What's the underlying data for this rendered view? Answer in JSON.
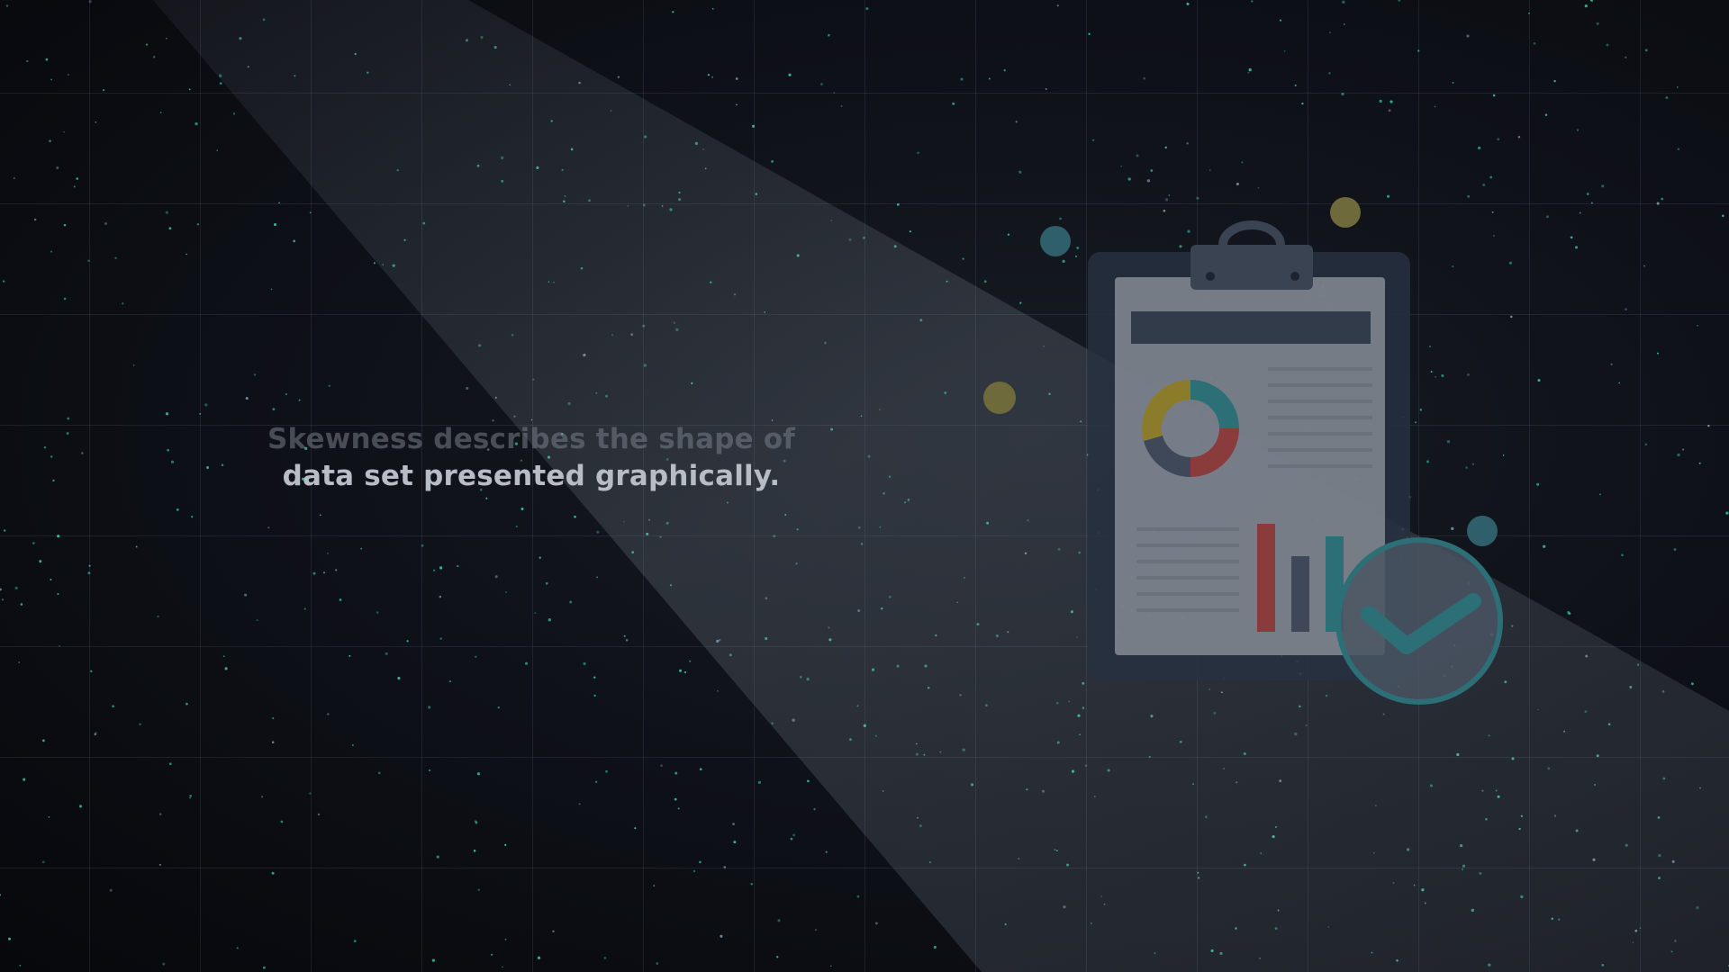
{
  "caption": {
    "line1": "Skewness describes the shape of",
    "line2": "data set presented graphically."
  },
  "colors": {
    "background": "#0b0d12",
    "dot_accent": "#3fd3b6",
    "beam": "#9aa4b4",
    "clipboard_frame": "#2b3444",
    "paper": "#9aa0a8",
    "header_bar": "#3a4352",
    "donut_yellow": "#8a7c2a",
    "donut_teal": "#2d6f76",
    "donut_red": "#8a3b3b",
    "donut_slate": "#3f4858",
    "bar_red": "#8a3b3b",
    "bar_dark": "#3f4858",
    "bar_teal": "#2d6f76",
    "check_ring": "#2d6f76",
    "check_fill": "#4a5563",
    "check_mark": "#2d6f76",
    "bubble_teal": "#2f5f6b",
    "bubble_gold": "#6f6a3c"
  },
  "illustration": {
    "icons": [
      "clipboard-icon",
      "donut-chart-icon",
      "bar-chart-icon",
      "checkmark-icon"
    ]
  }
}
